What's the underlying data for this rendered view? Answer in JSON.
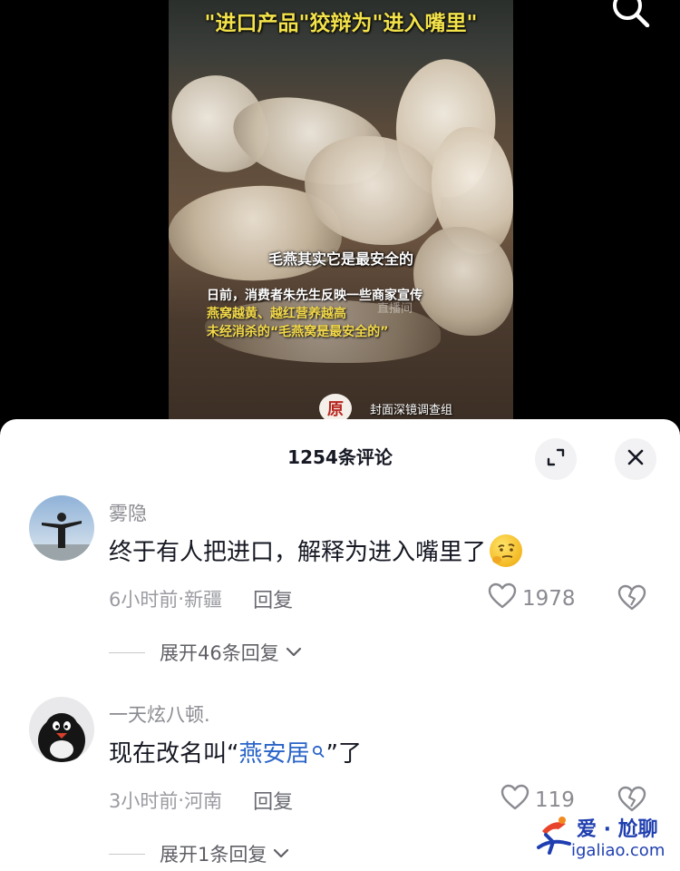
{
  "video": {
    "title": "\"进口产品\"狡辩为\"进入嘴里\"",
    "caption_main": "毛燕其实它是最安全的",
    "caption_lines": [
      "日前，消费者朱先生反映一些商家宣传",
      "燕窝越黄、越红营养越高",
      "未经消杀的“毛燕窝是最安全的”"
    ],
    "ghost_text": "直播间",
    "logo_text": "封面深镜调查组",
    "logo_badge": "原"
  },
  "comments_header": {
    "title": "1254条评论"
  },
  "comments": [
    {
      "username": "雾隐",
      "text": "终于有人把进口，解释为进入嘴里了",
      "time": "6小时前",
      "separator": " · ",
      "location": "新疆",
      "reply_label": "回复",
      "likes": "1978",
      "expand_label": "展开46条回复"
    },
    {
      "username": "一天炫八顿.",
      "text_before": "现在改名叫“",
      "text_link": "燕安居",
      "text_after": "”了",
      "time": "3小时前",
      "separator": " · ",
      "location": "河南",
      "reply_label": "回复",
      "likes": "119",
      "expand_label": "展开1条回复"
    }
  ],
  "watermark": {
    "title": "爱 · 尬聊",
    "url": "igaliao.com"
  },
  "colors": {
    "sheet_bg": "#ffffff",
    "link_blue": "#2a64c8",
    "caption_yellow": "#f3d94a"
  }
}
